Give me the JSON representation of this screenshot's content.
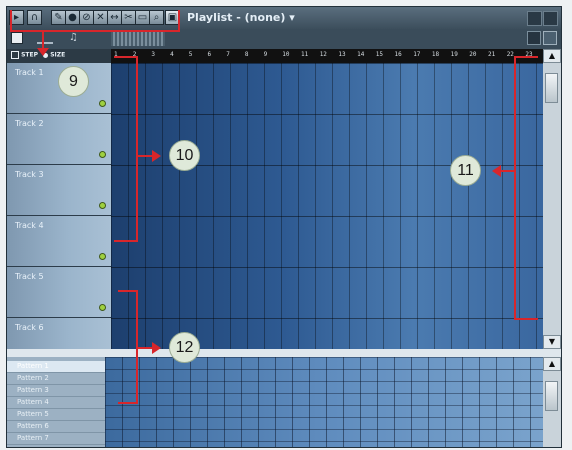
{
  "window": {
    "title": "Playlist - (none)",
    "title_arrow": "▾"
  },
  "toolbar": {
    "icons": [
      "menu-icon",
      "magnet-icon",
      "pencil-icon",
      "paint-icon",
      "delete-icon",
      "mute-icon",
      "slip-icon",
      "slice-icon",
      "select-icon",
      "zoom-icon",
      "playback-icon"
    ]
  },
  "ruler": {
    "step_label": "STEP",
    "size_label": "SIZE",
    "bars": [
      "1",
      "2",
      "3",
      "4",
      "5",
      "6",
      "7",
      "8",
      "9",
      "10",
      "11",
      "12",
      "13",
      "14",
      "15",
      "16",
      "17",
      "18",
      "19",
      "20",
      "21",
      "22",
      "23"
    ]
  },
  "tracks": [
    "Track 1",
    "Track 2",
    "Track 3",
    "Track 4",
    "Track 5",
    "Track 6"
  ],
  "patterns": [
    "Pattern 1",
    "Pattern 2",
    "Pattern 3",
    "Pattern 4",
    "Pattern 5",
    "Pattern 6",
    "Pattern 7"
  ],
  "annotations": {
    "c9": "9",
    "c10": "10",
    "c11": "11",
    "c12": "12"
  },
  "scroll": {
    "up": "▲",
    "down": "▼"
  }
}
